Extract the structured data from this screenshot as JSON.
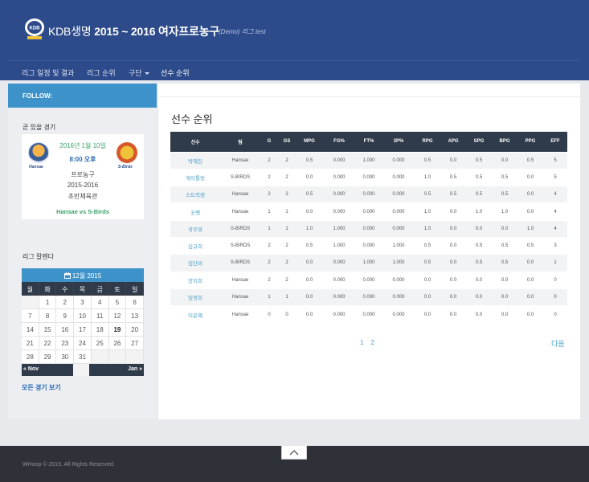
{
  "header": {
    "logo_text": "KDB",
    "title_brand": "KDB생명",
    "title_rest": " 2015 ~ 2016 여자프로농구",
    "tag": "(Demo) 리그 test"
  },
  "nav": {
    "items": [
      {
        "label": "리그 일정 및 결과"
      },
      {
        "label": "리그 순위"
      },
      {
        "label": "구단"
      },
      {
        "label": "선수 순위"
      }
    ]
  },
  "sidebar": {
    "follow_label": "FOLLOW:",
    "upcoming_heading": "곧 있을 경기",
    "game": {
      "date": "2016년 1월 10일",
      "time": "8:00 오후",
      "league": "프로농구",
      "season": "2015-2016",
      "venue": "초반체육관",
      "matchup": "Hansae vs S-Birds",
      "left_logo_caption": "Hansae",
      "right_logo_caption": "S-Birds"
    },
    "calendar_heading": "리그 칼렌다",
    "calendar": {
      "month_label": "12월 2015",
      "dow": [
        "월",
        "화",
        "수",
        "목",
        "금",
        "토",
        "일"
      ],
      "weeks": [
        [
          "",
          "1",
          "2",
          "3",
          "4",
          "5",
          "6"
        ],
        [
          "7",
          "8",
          "9",
          "10",
          "11",
          "12",
          "13"
        ],
        [
          "14",
          "15",
          "16",
          "17",
          "18",
          "19",
          "20"
        ],
        [
          "21",
          "22",
          "23",
          "24",
          "25",
          "26",
          "27"
        ],
        [
          "28",
          "29",
          "30",
          "31",
          "",
          "",
          ""
        ]
      ],
      "today": "19",
      "prev_label": "« Nov",
      "next_label": "Jan »"
    },
    "all_games_label": "모든 경기 보기"
  },
  "main": {
    "title": "선수 순위",
    "columns": [
      "선수",
      "팀",
      "G",
      "GS",
      "MPG",
      "FG%",
      "FT%",
      "3P%",
      "RPG",
      "APG",
      "SPG",
      "BPG",
      "PPG",
      "EFF"
    ],
    "rows": [
      [
        "박혜진",
        "Hansae",
        "2",
        "2",
        "0.5",
        "0.000",
        "1.000",
        "0.000",
        "0.5",
        "0.0",
        "0.5",
        "0.0",
        "0.5",
        "5"
      ],
      [
        "게이틀링",
        "S-BIRDS",
        "2",
        "2",
        "0.0",
        "0.000",
        "0.000",
        "0.000",
        "1.0",
        "0.5",
        "0.5",
        "0.5",
        "0.0",
        "5"
      ],
      [
        "스트릭랜",
        "Hansae",
        "2",
        "2",
        "0.5",
        "0.000",
        "0.000",
        "0.000",
        "0.5",
        "0.5",
        "0.5",
        "0.5",
        "0.0",
        "4"
      ],
      [
        "곳쨋",
        "Hansae",
        "1",
        "1",
        "0.0",
        "0.000",
        "0.000",
        "0.000",
        "1.0",
        "0.0",
        "1.0",
        "1.0",
        "0.0",
        "4"
      ],
      [
        "곽주영",
        "S-BIRDS",
        "1",
        "1",
        "1.0",
        "1.000",
        "0.000",
        "0.000",
        "1.0",
        "0.0",
        "0.0",
        "0.0",
        "1.0",
        "4"
      ],
      [
        "김규희",
        "S-BIRDS",
        "2",
        "2",
        "0.5",
        "1.000",
        "0.000",
        "1.000",
        "0.5",
        "0.0",
        "0.5",
        "0.5",
        "0.5",
        "3"
      ],
      [
        "김단비",
        "S-BIRDS",
        "2",
        "2",
        "0.0",
        "0.000",
        "1.000",
        "1.000",
        "0.5",
        "0.0",
        "0.5",
        "0.5",
        "0.0",
        "1"
      ],
      [
        "양지희",
        "Hansae",
        "2",
        "2",
        "0.0",
        "0.000",
        "0.000",
        "0.000",
        "0.0",
        "0.0",
        "0.0",
        "0.0",
        "0.0",
        "0"
      ],
      [
        "임영희",
        "Hansae",
        "1",
        "1",
        "0.0",
        "0.000",
        "0.000",
        "0.000",
        "0.0",
        "0.0",
        "0.0",
        "0.0",
        "0.0",
        "0"
      ],
      [
        "이은혜",
        "Hansae",
        "0",
        "0",
        "0.0",
        "0.000",
        "0.000",
        "0.000",
        "0.0",
        "0.0",
        "0.0",
        "0.0",
        "0.0",
        "0"
      ]
    ],
    "pages": [
      "1",
      "2"
    ],
    "next_label": "다음"
  },
  "footer": {
    "copyright": "WHoop © 2015. All Rights Reserved."
  },
  "colors": {
    "header": "#2d4a8a",
    "accent": "#3d93c9",
    "table_header": "#2f3a4a",
    "link": "#4aa0c9",
    "footer": "#2e3238"
  },
  "icons": [
    "kdb-logo-icon",
    "calendar-icon",
    "caret-down-icon",
    "chevron-up-icon"
  ]
}
